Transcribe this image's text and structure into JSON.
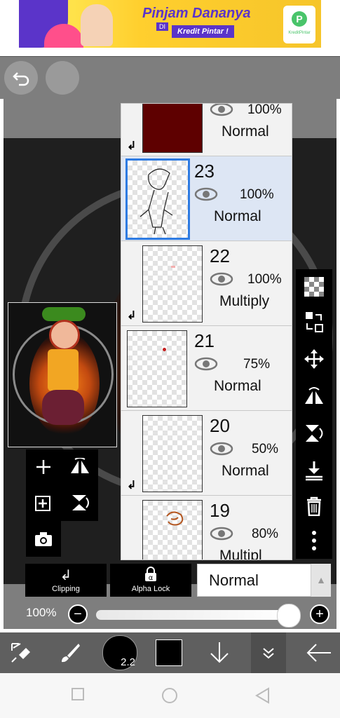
{
  "ad": {
    "title": "Pinjam Dananya",
    "di": "DI",
    "subtitle": "Kredit Pintar !",
    "logo_text": "KreditPintar"
  },
  "top": {
    "undo_icon": "undo-arrow-icon",
    "redo_icon": "redo-icon"
  },
  "layers": [
    {
      "number": "",
      "opacity": "100%",
      "blend": "Normal",
      "thumb": "dark-red-fill",
      "clipping": true
    },
    {
      "number": "23",
      "opacity": "100%",
      "blend": "Normal",
      "thumb": "line-art",
      "selected": true
    },
    {
      "number": "22",
      "opacity": "100%",
      "blend": "Multiply",
      "thumb": "transparent",
      "clipping": true
    },
    {
      "number": "21",
      "opacity": "75%",
      "blend": "Normal",
      "thumb": "transparent"
    },
    {
      "number": "20",
      "opacity": "50%",
      "blend": "Normal",
      "thumb": "transparent",
      "clipping": true
    },
    {
      "number": "19",
      "opacity": "80%",
      "blend": "Multipl",
      "thumb": "brown-sketch"
    }
  ],
  "right_tools": [
    "checker-transparent-icon",
    "swap-layer-icon",
    "move-icon",
    "flip-horizontal-icon",
    "flip-vertical-icon",
    "merge-down-icon",
    "trash-icon",
    "more-vertical-icon"
  ],
  "left_tools": [
    "add-layer-icon",
    "flip-layer-icon",
    "add-folder-icon",
    "rotate-icon",
    "camera-icon"
  ],
  "controls": {
    "clipping_label": "Clipping",
    "alpha_lock_label": "Alpha Lock",
    "blend_mode": "Normal",
    "opacity_label": "100%",
    "opacity_value": 1.0
  },
  "bottom_bar": {
    "brush_size": "2.2",
    "color": "#000000"
  }
}
